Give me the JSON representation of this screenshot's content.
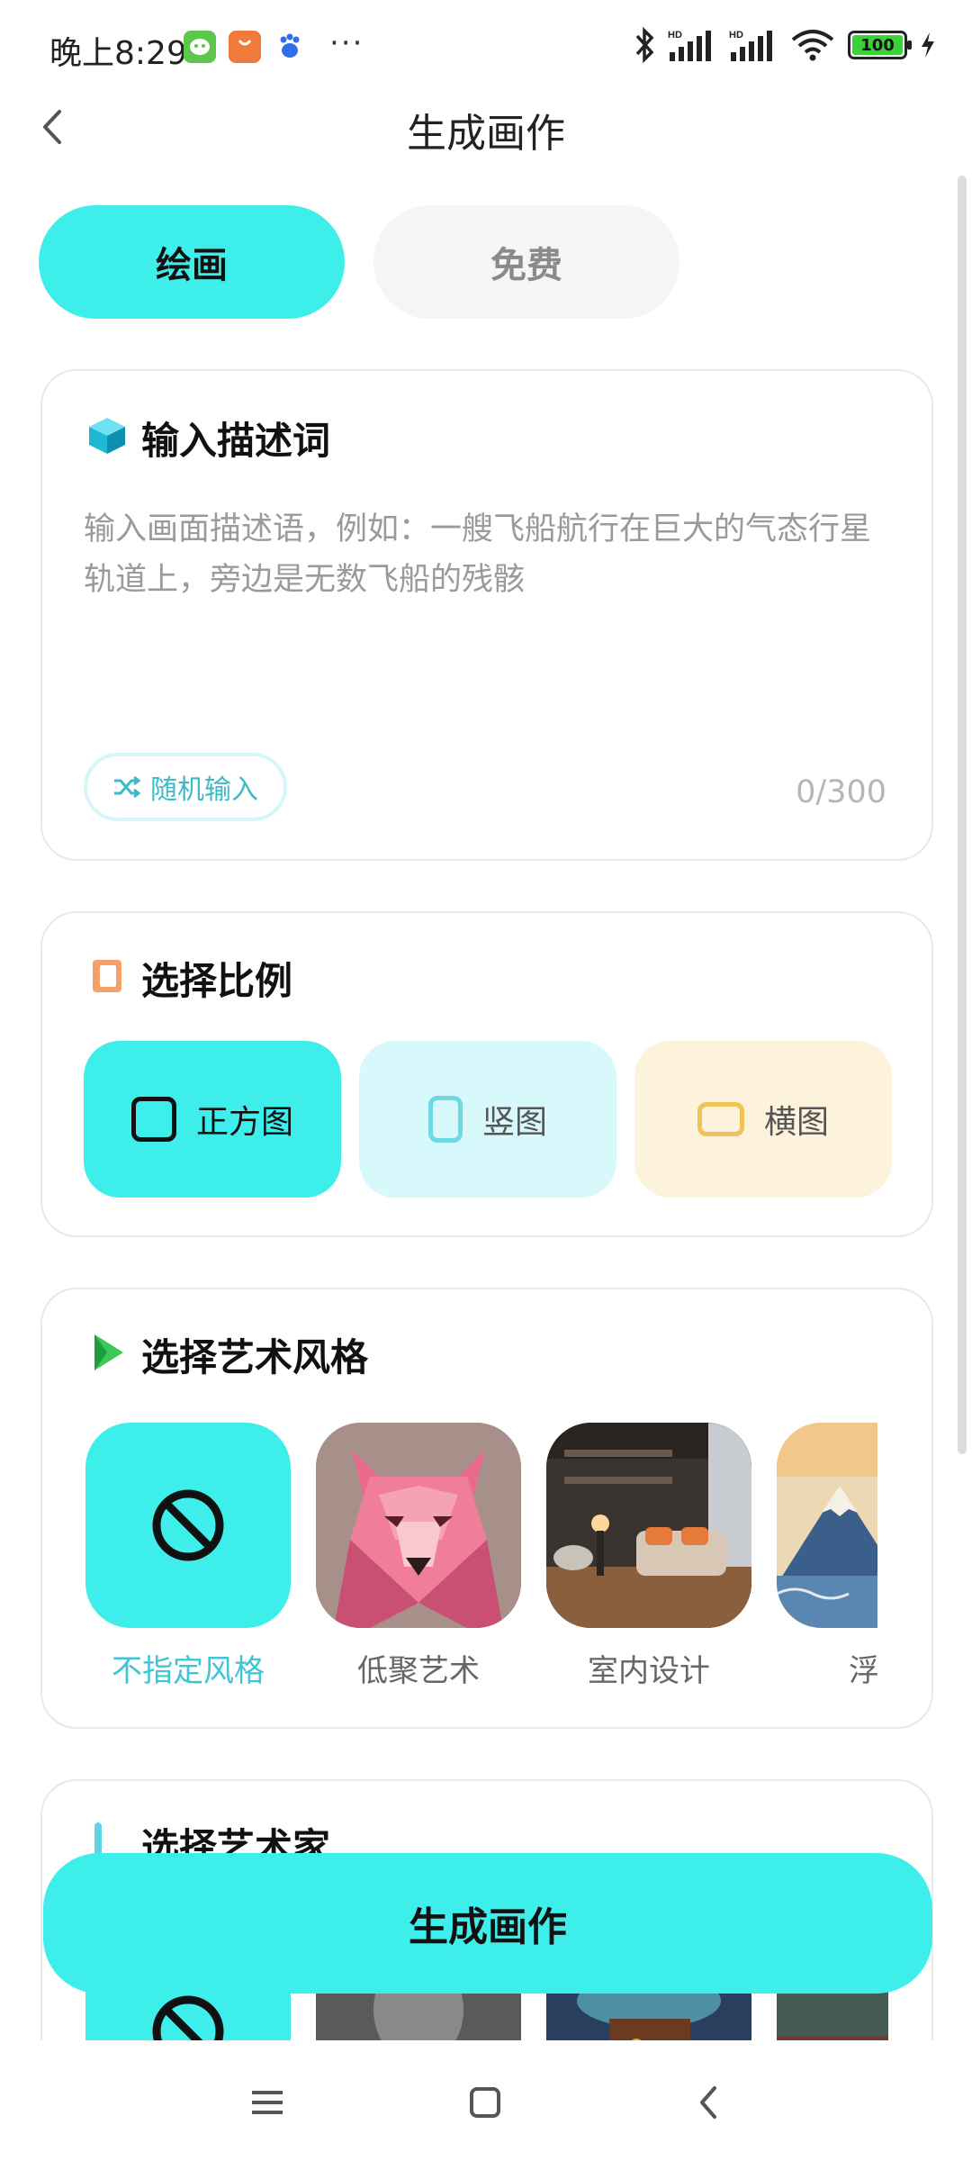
{
  "status_bar": {
    "time": "晚上8:29",
    "more": "···",
    "battery": "100",
    "signal_label": "HD",
    "wifi_label": "6"
  },
  "header": {
    "title": "生成画作"
  },
  "tabs": [
    {
      "label": "绘画",
      "active": true
    },
    {
      "label": "免费",
      "active": false
    }
  ],
  "prompt_card": {
    "title": "输入描述词",
    "placeholder": "输入画面描述语，例如：一艘飞船航行在巨大的气态行星轨道上，旁边是无数飞船的残骸",
    "random_label": "随机输入",
    "counter": "0/300"
  },
  "ratio_card": {
    "title": "选择比例",
    "options": [
      {
        "label": "正方图",
        "selected": true
      },
      {
        "label": "竖图",
        "selected": false
      },
      {
        "label": "横图",
        "selected": false
      }
    ]
  },
  "style_card": {
    "title": "选择艺术风格",
    "items": [
      {
        "label": "不指定风格",
        "selected": true
      },
      {
        "label": "低聚艺术",
        "selected": false
      },
      {
        "label": "室内设计",
        "selected": false
      },
      {
        "label": "浮世",
        "selected": false
      }
    ]
  },
  "artist_card": {
    "title": "选择艺术家"
  },
  "generate_button": {
    "label": "生成画作"
  },
  "colors": {
    "accent": "#3EEEEA",
    "accent_text": "#3EC6D6",
    "tab_inactive_bg": "#F4F5F7"
  }
}
